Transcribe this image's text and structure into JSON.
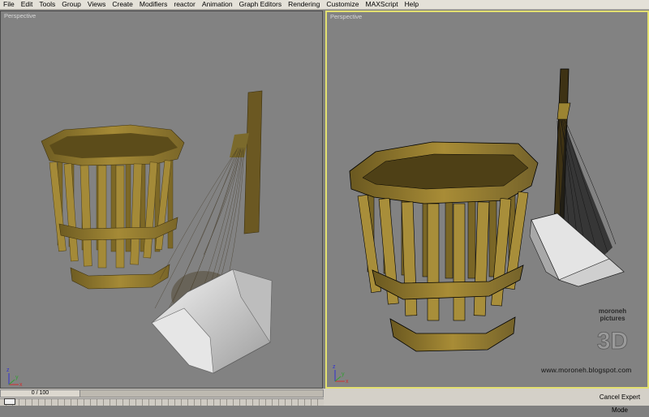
{
  "menu": [
    {
      "label": "File"
    },
    {
      "label": "Edit"
    },
    {
      "label": "Tools"
    },
    {
      "label": "Group"
    },
    {
      "label": "Views"
    },
    {
      "label": "Create"
    },
    {
      "label": "Modifiers"
    },
    {
      "label": "reactor"
    },
    {
      "label": "Animation"
    },
    {
      "label": "Graph Editors"
    },
    {
      "label": "Rendering"
    },
    {
      "label": "Customize"
    },
    {
      "label": "MAXScript"
    },
    {
      "label": "Help"
    }
  ],
  "viewports": {
    "left": {
      "label": "Perspective",
      "shading": "smooth",
      "active": false
    },
    "right": {
      "label": "Perspective",
      "shading": "smooth+edged-faces",
      "active": true
    }
  },
  "axis_labels": {
    "x": "x",
    "y": "y",
    "z": "z"
  },
  "timeline": {
    "frame_text": "0 / 100"
  },
  "status": {
    "expert_mode_label": "Cancel Expert Mode"
  },
  "watermark": {
    "logo_line1": "moroneh",
    "logo_line2": "pictures",
    "logo_3d": "3D",
    "url": "www.moroneh.blogspot.com"
  },
  "colors": {
    "viewport_bg": "#828282",
    "active_border": "#e3e070",
    "basket_wood": "#9b8232",
    "basket_shadow": "#5e4d1a",
    "dustpan": "#d8d8d8",
    "broom_handle": "#6b5822",
    "menubar_bg": "#e4e1d8"
  }
}
